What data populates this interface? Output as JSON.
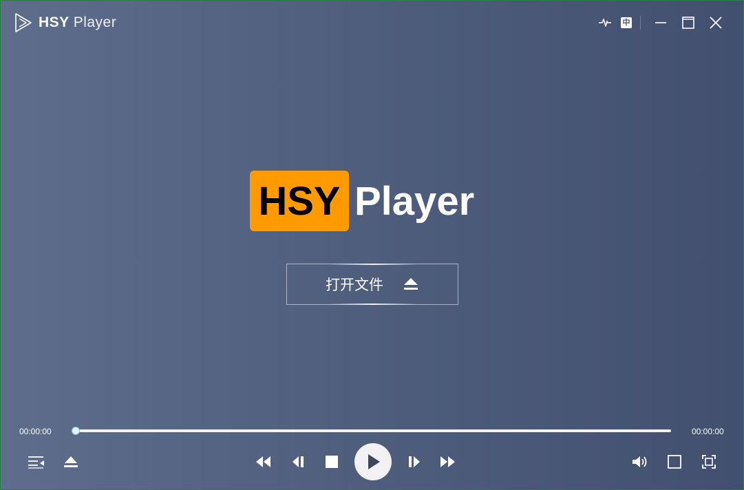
{
  "titlebar": {
    "app_name_bold": "HSY",
    "app_name_light": "Player",
    "icons": [
      "waveform-icon",
      "chinese-language-icon",
      "minimize-icon",
      "maximize-icon",
      "close-icon"
    ],
    "lang_label": "中"
  },
  "hero": {
    "brand_box_text": "HSY",
    "brand_text": "Player",
    "brand_color": "#ff9a00"
  },
  "open_file": {
    "label": "打开文件",
    "icon": "eject-icon"
  },
  "progress": {
    "elapsed": "00:00:00",
    "total": "00:00:00",
    "fraction": 0,
    "accent": "#7ec3ff"
  },
  "controls": {
    "left": [
      "playlist-icon",
      "eject-icon"
    ],
    "center": [
      "rewind-icon",
      "previous-frame-icon",
      "stop-icon",
      "play-icon",
      "next-frame-icon",
      "fast-forward-icon"
    ],
    "right": [
      "volume-icon",
      "window-mode-icon",
      "fullscreen-icon"
    ]
  }
}
